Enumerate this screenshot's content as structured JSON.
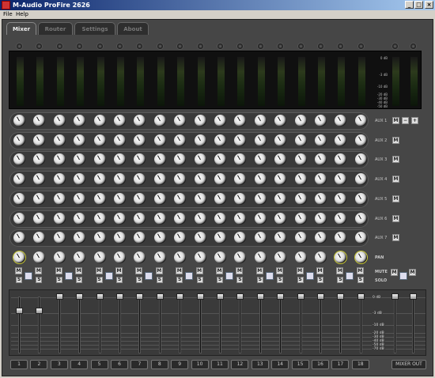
{
  "window": {
    "title": "M-Audio ProFire 2626",
    "min": "_",
    "max": "□",
    "close": "×"
  },
  "menu": {
    "items": [
      "File",
      "Help"
    ]
  },
  "tabs": [
    {
      "label": "Mixer",
      "active": true
    },
    {
      "label": "Router"
    },
    {
      "label": "Settings"
    },
    {
      "label": "About"
    }
  ],
  "meters": {
    "scale": [
      "0 dB",
      "-3 dB",
      "-10 dB",
      "-20 dB",
      "-30 dB",
      "-40 dB",
      "-50 dB"
    ]
  },
  "aux": [
    "AUX 1",
    "AUX 2",
    "AUX 3",
    "AUX 4",
    "AUX 5",
    "AUX 6",
    "AUX 7"
  ],
  "aux_mute": "M",
  "aux_minus": "−",
  "aux_plus": "+",
  "pan_label": "PAN",
  "mute_label": "MUTE",
  "solo_label": "SOLO",
  "mute_btn": "M",
  "solo_btn": "S",
  "fader_scale": [
    "0 dB",
    "-3 dB",
    "-10 dB",
    "-20 dB",
    "-30 dB",
    "-40 dB",
    "-50 dB",
    "-70 dB"
  ],
  "channels": [
    "1",
    "2",
    "3",
    "4",
    "5",
    "6",
    "7",
    "8",
    "9",
    "10",
    "11",
    "12",
    "13",
    "14",
    "15",
    "16",
    "17",
    "18"
  ],
  "mixer_out": "MIXER OUT"
}
